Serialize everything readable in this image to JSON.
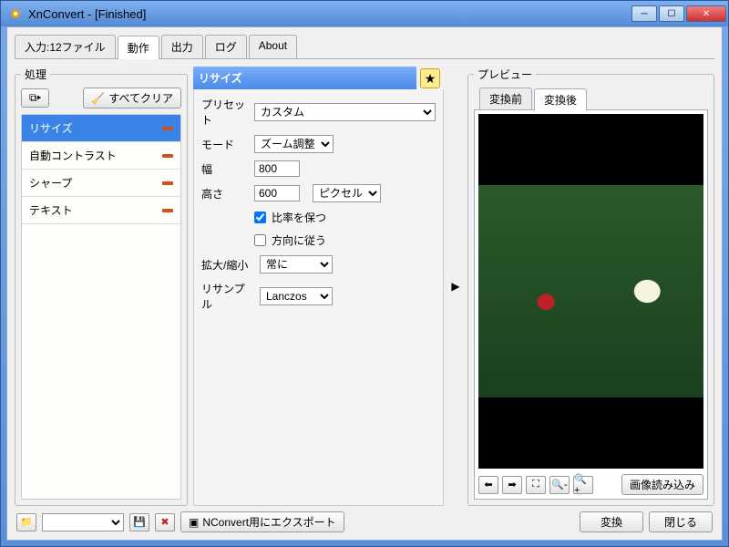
{
  "window": {
    "title": "XnConvert - [Finished]"
  },
  "tabs": {
    "input": "入力:12ファイル",
    "actions": "動作",
    "output": "出力",
    "log": "ログ",
    "about": "About"
  },
  "processing": {
    "legend": "処理",
    "clear_all": "すべてクリア",
    "items": [
      {
        "label": "リサイズ"
      },
      {
        "label": "自動コントラスト"
      },
      {
        "label": "シャープ"
      },
      {
        "label": "テキスト"
      }
    ]
  },
  "resize_panel": {
    "title": "リサイズ",
    "preset_label": "プリセット",
    "preset_value": "カスタム",
    "mode_label": "モード",
    "mode_value": "ズーム調整",
    "width_label": "幅",
    "width_value": "800",
    "height_label": "高さ",
    "height_value": "600",
    "unit_value": "ピクセル",
    "keep_ratio": "比率を保つ",
    "follow_orientation": "方向に従う",
    "enlarge_label": "拡大/縮小",
    "enlarge_value": "常に",
    "resample_label": "リサンプル",
    "resample_value": "Lanczos"
  },
  "preview": {
    "legend": "プレビュー",
    "before": "変換前",
    "after": "変換後",
    "load_image": "画像読み込み"
  },
  "footer": {
    "export": "NConvert用にエクスポート",
    "convert": "変換",
    "close": "閉じる"
  }
}
